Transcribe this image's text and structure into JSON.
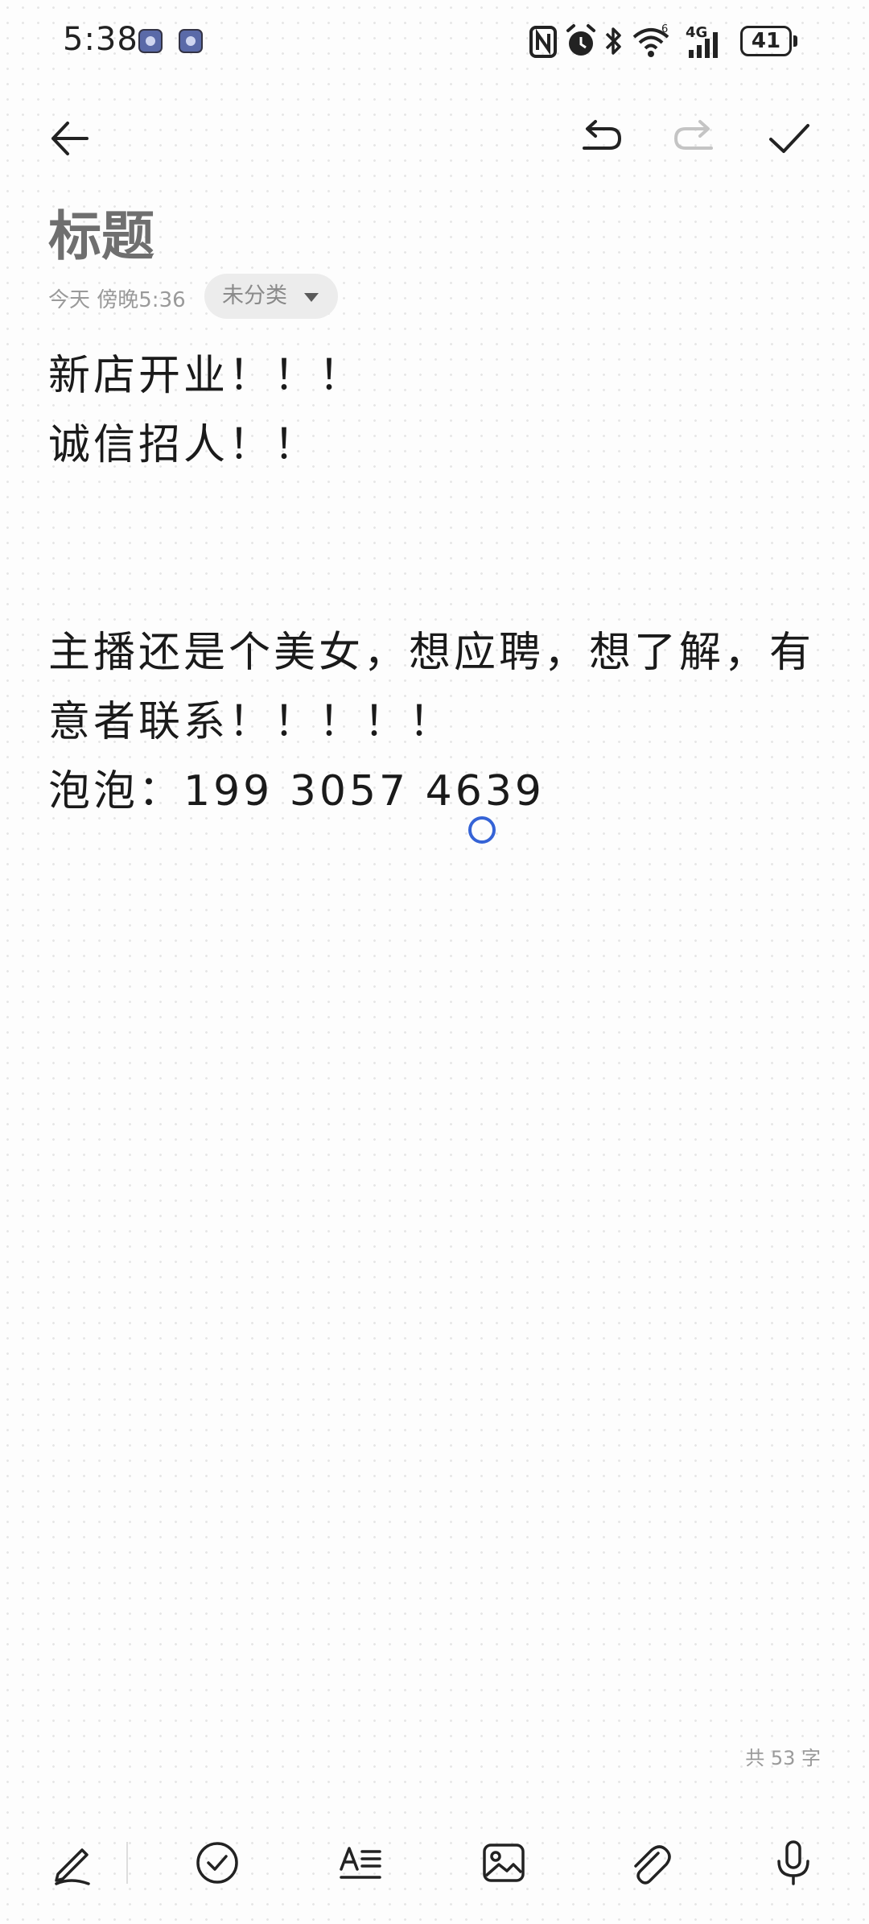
{
  "status_bar": {
    "time": "5:38",
    "network_label": "4G",
    "battery_level": "41",
    "icons": [
      "notification-app-icon",
      "notification-app-icon",
      "nfc-icon",
      "alarm-icon",
      "bluetooth-icon",
      "wifi-icon",
      "cellular-signal-icon",
      "battery-icon"
    ]
  },
  "toolbar": {
    "icons": [
      "back-arrow-icon",
      "undo-icon",
      "redo-icon",
      "checkmark-icon"
    ],
    "redo_enabled": false
  },
  "note": {
    "title": "标题",
    "date": "今天 傍晚5:36",
    "category": "未分类",
    "lines": [
      "新店开业！！！",
      "诚信招人！！",
      "",
      "",
      "主播还是个美女，想应聘，想了解，有",
      "意者联系！！！！！",
      "泡泡：199 3057 4639"
    ],
    "word_count": "共 53 字"
  },
  "bottom_toolbar": {
    "icons": [
      "pen-icon",
      "checklist-icon",
      "text-format-icon",
      "image-icon",
      "attachment-icon",
      "microphone-icon"
    ]
  },
  "colors": {
    "accent": "#3563d6",
    "title_gray": "#6f6f6f",
    "meta_gray": "#9a9a9a"
  }
}
